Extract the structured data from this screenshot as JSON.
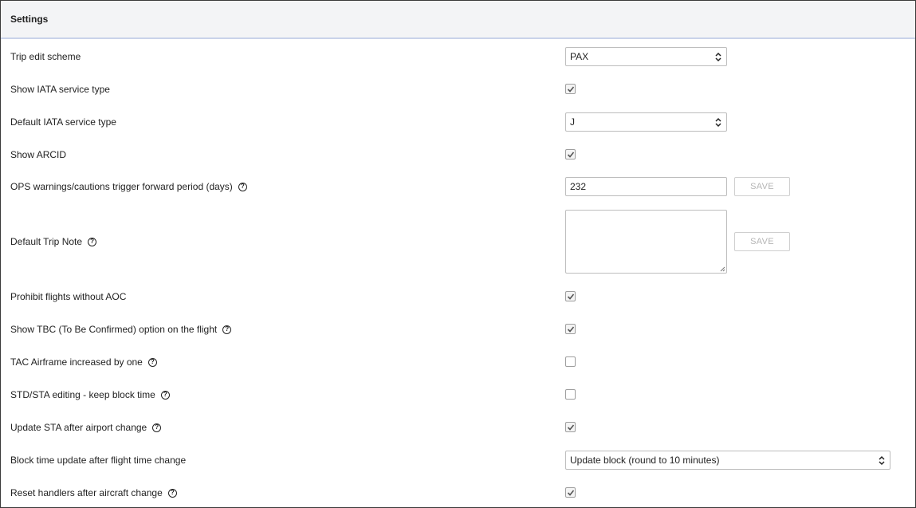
{
  "header": {
    "title": "Settings"
  },
  "settings": {
    "trip_edit_scheme": {
      "label": "Trip edit scheme",
      "value": "PAX"
    },
    "show_iata_service_type": {
      "label": "Show IATA service type",
      "checked": true
    },
    "default_iata_service_type": {
      "label": "Default IATA service type",
      "value": "J"
    },
    "show_arcid": {
      "label": "Show ARCID",
      "checked": true
    },
    "ops_warnings_period": {
      "label": "OPS warnings/cautions trigger forward period (days)",
      "value": "232",
      "save_label": "SAVE"
    },
    "default_trip_note": {
      "label": "Default Trip Note",
      "value": "",
      "save_label": "SAVE"
    },
    "prohibit_flights_without_aoc": {
      "label": "Prohibit flights without AOC",
      "checked": true
    },
    "show_tbc_option": {
      "label": "Show TBC (To Be Confirmed) option on the flight",
      "checked": true
    },
    "tac_airframe_increase": {
      "label": "TAC Airframe increased by one",
      "checked": false
    },
    "std_sta_keep_block": {
      "label": "STD/STA editing - keep block time",
      "checked": false
    },
    "update_sta_after_airport": {
      "label": "Update STA after airport change",
      "checked": true
    },
    "block_time_update": {
      "label": "Block time update after flight time change",
      "value": "Update block (round to 10 minutes)"
    },
    "reset_handlers": {
      "label": "Reset handlers after aircraft change",
      "checked": true
    }
  },
  "icons": {
    "help": "help-circle-icon",
    "chevron": "chevron-up-down-icon",
    "check": "checkmark-icon"
  }
}
